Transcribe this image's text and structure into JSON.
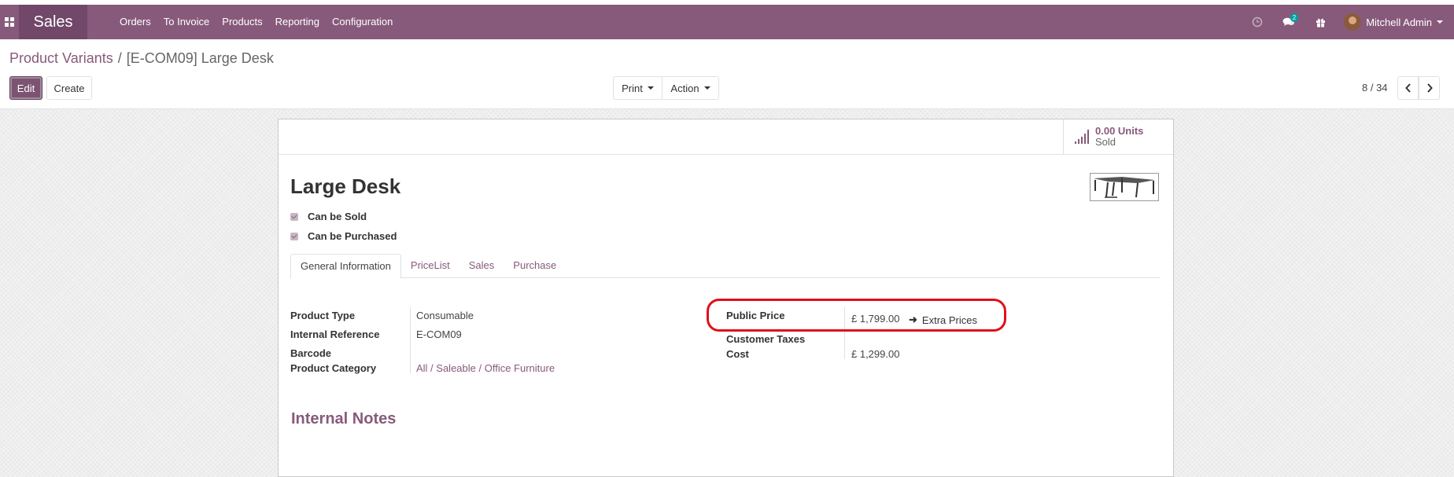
{
  "app": {
    "name": "Sales"
  },
  "menu": [
    "Orders",
    "To Invoice",
    "Products",
    "Reporting",
    "Configuration"
  ],
  "nav_right": {
    "messages_count": "2",
    "user_name": "Mitchell Admin"
  },
  "breadcrumb": {
    "parent": "Product Variants",
    "separator": "/",
    "current": "[E-COM09] Large Desk"
  },
  "toolbar": {
    "edit_label": "Edit",
    "create_label": "Create",
    "print_label": "Print",
    "action_label": "Action"
  },
  "pager": {
    "value": "8 / 34"
  },
  "stat": {
    "value": "0.00 Units",
    "label": "Sold"
  },
  "product": {
    "name": "Large Desk",
    "can_be_sold": "Can be Sold",
    "can_be_purchased": "Can be Purchased"
  },
  "tabs": [
    "General Information",
    "PriceList",
    "Sales",
    "Purchase"
  ],
  "left_fields": {
    "type_label": "Product Type",
    "type_value": "Consumable",
    "ref_label": "Internal Reference",
    "ref_value": "E-COM09",
    "barcode_label": "Barcode",
    "barcode_value": "",
    "category_label": "Product Category",
    "category_value": "All / Saleable / Office Furniture"
  },
  "right_fields": {
    "price_label": "Public Price",
    "price_value": "£ 1,799.00",
    "extra_prices": "Extra Prices",
    "taxes_label": "Customer Taxes",
    "taxes_value": "",
    "cost_label": "Cost",
    "cost_value": "£ 1,299.00"
  },
  "notes": {
    "title": "Internal Notes"
  },
  "colors": {
    "brand": "#875a7b",
    "annotation": "#e0101a"
  }
}
